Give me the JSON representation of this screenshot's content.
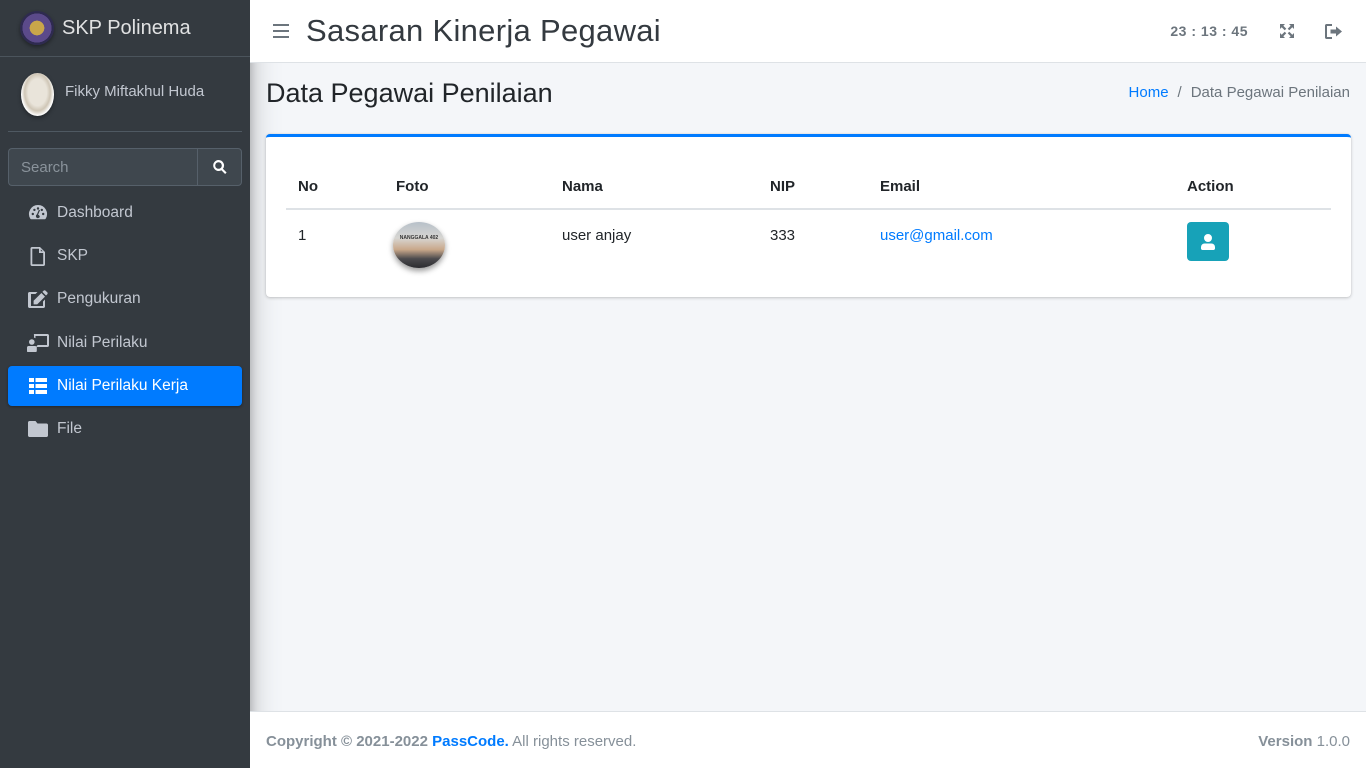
{
  "brand": {
    "name": "SKP Polinema"
  },
  "user": {
    "name": "Fikky Miftakhul Huda"
  },
  "search": {
    "placeholder": "Search"
  },
  "sidebar": {
    "items": [
      {
        "label": "Dashboard",
        "icon": "tachometer-icon",
        "active": false
      },
      {
        "label": "SKP",
        "icon": "file-icon",
        "active": false
      },
      {
        "label": "Pengukuran",
        "icon": "edit-icon",
        "active": false
      },
      {
        "label": "Nilai Perilaku",
        "icon": "chalkboard-user-icon",
        "active": false
      },
      {
        "label": "Nilai Perilaku Kerja",
        "icon": "table-list-icon",
        "active": true
      },
      {
        "label": "File",
        "icon": "folder-icon",
        "active": false
      }
    ]
  },
  "header": {
    "title": "Sasaran Kinerja Pegawai",
    "clock": "23 : 13 : 45"
  },
  "page": {
    "title": "Data Pegawai Penilaian",
    "breadcrumb": {
      "home": "Home",
      "separator": "/",
      "current": "Data Pegawai Penilaian"
    }
  },
  "table": {
    "columns": [
      "No",
      "Foto",
      "Nama",
      "NIP",
      "Email",
      "Action"
    ],
    "rows": [
      {
        "no": "1",
        "photo_caption": "NANGGALA 402",
        "nama": "user anjay",
        "nip": "333",
        "email": "user@gmail.com"
      }
    ]
  },
  "footer": {
    "copyright": "Copyright © 2021-2022",
    "company": "PassCode.",
    "rights": "All rights reserved.",
    "version_label": "Version",
    "version": "1.0.0"
  },
  "colors": {
    "sidebar_bg": "#343a40",
    "accent": "#007bff",
    "action_button": "#17a2b8",
    "content_bg": "#f4f6f9"
  }
}
